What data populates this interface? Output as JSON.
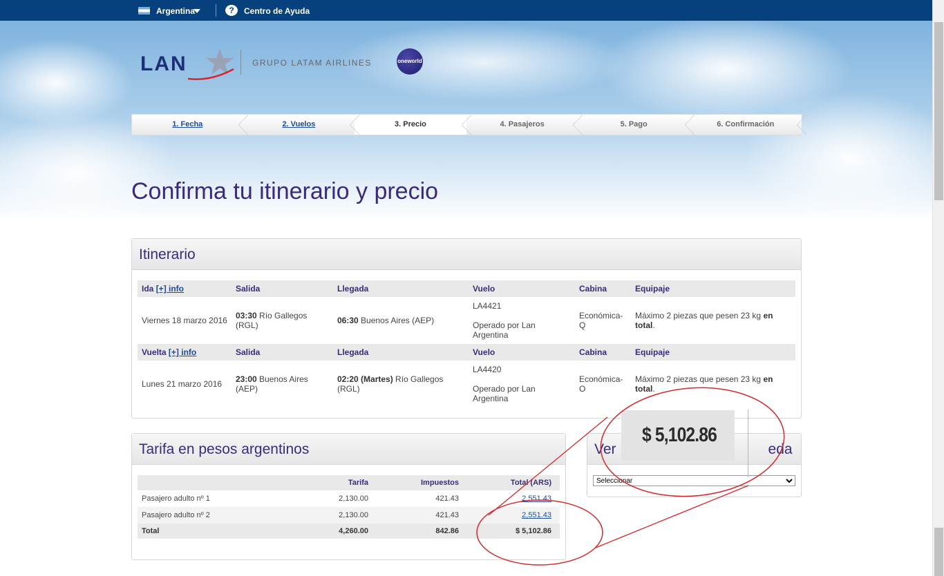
{
  "topbar": {
    "country": "Argentina",
    "help": "Centro de Ayuda"
  },
  "logo": {
    "brand": "LAN",
    "group": "GRUPO LATAM AIRLINES",
    "alliance": "oneworld"
  },
  "steps": [
    {
      "label": "1. Fecha",
      "state": "done"
    },
    {
      "label": "2. Vuelos",
      "state": "done"
    },
    {
      "label": "3. Precio",
      "state": "current"
    },
    {
      "label": "4. Pasajeros",
      "state": "pending"
    },
    {
      "label": "5. Pago",
      "state": "pending"
    },
    {
      "label": "6. Confirmación",
      "state": "pending"
    }
  ],
  "page_title": "Confirma tu itinerario y precio",
  "itinerary": {
    "title": "Itinerario",
    "info_link": "[+] info",
    "columns": {
      "salida": "Salida",
      "llegada": "Llegada",
      "vuelo": "Vuelo",
      "cabina": "Cabina",
      "equipaje": "Equipaje"
    },
    "ida": {
      "label": "Ida",
      "date": "Viernes 18 marzo 2016",
      "dep_time": "03:30",
      "dep_place": " Río Gallegos (RGL)",
      "arr_time": "06:30",
      "arr_place": " Buenos Aires (AEP)",
      "flight": "LA4421",
      "operated": "Operado por Lan Argentina",
      "cabin": "Económica-Q",
      "baggage_pre": "Máximo 2 piezas que pesen 23 kg ",
      "baggage_bold": "en total",
      "baggage_post": "."
    },
    "vuelta": {
      "label": "Vuelta",
      "date": "Lunes 21 marzo 2016",
      "dep_time": "23:00",
      "dep_place": " Buenos Aires (AEP)",
      "arr_time": "02:20 (Martes)",
      "arr_place": " Río Gallegos (RGL)",
      "flight": "LA4420",
      "operated": "Operado por Lan Argentina",
      "cabin": "Económica-O",
      "baggage_pre": "Máximo 2 piezas que pesen 23 kg ",
      "baggage_bold": "en total",
      "baggage_post": "."
    }
  },
  "fare": {
    "title": "Tarifa en pesos argentinos",
    "headers": {
      "tarifa": "Tarifa",
      "impuestos": "Impuestos",
      "total": "Total (ARS)"
    },
    "rows": [
      {
        "label": "Pasajero adulto nº 1",
        "tarifa": "2,130.00",
        "impuestos": "421.43",
        "total": "2,551.43"
      },
      {
        "label": "Pasajero adulto nº 2",
        "tarifa": "2,130.00",
        "impuestos": "421.43",
        "total": "2,551.43"
      }
    ],
    "total_row": {
      "label": "Total",
      "tarifa": "4,260.00",
      "impuestos": "842.86",
      "total": "$ 5,102.86"
    }
  },
  "currency": {
    "title_left": "Ver",
    "title_right": "eda",
    "select_value": "Seleccionar"
  },
  "zoom_callout": {
    "amount": "$ 5,102.86"
  },
  "colors": {
    "topbar": "#07417d",
    "title": "#3b2a7a",
    "link": "#1a4b9c",
    "annotation": "#d6262b"
  }
}
